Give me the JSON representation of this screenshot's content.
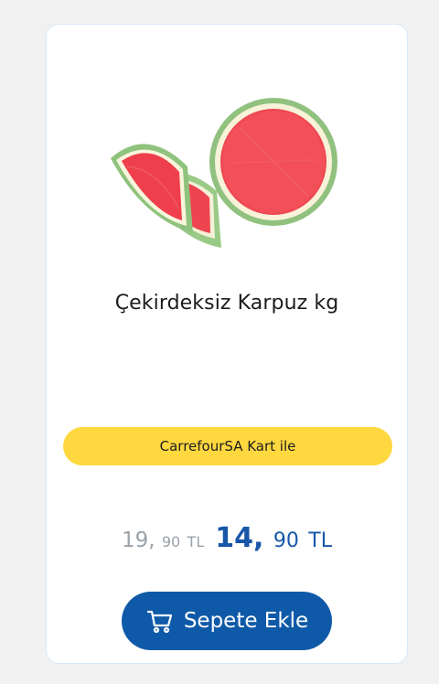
{
  "product": {
    "title": "Çekirdeksiz Karpuz kg",
    "image_alt": "watermelon"
  },
  "promotion": {
    "label": "CarrefourSA Kart ile",
    "color": "#ffd83f"
  },
  "pricing": {
    "old_whole": "19,",
    "old_decimal": "90",
    "old_currency": "TL",
    "new_whole": "14,",
    "new_decimal": "90",
    "new_currency": "TL",
    "old_color": "#9aa2aa",
    "new_color": "#1756a9"
  },
  "actions": {
    "add_to_cart_label": "Sepete Ekle",
    "add_to_cart_icon": "cart-icon",
    "button_color": "#0f5aa8"
  }
}
